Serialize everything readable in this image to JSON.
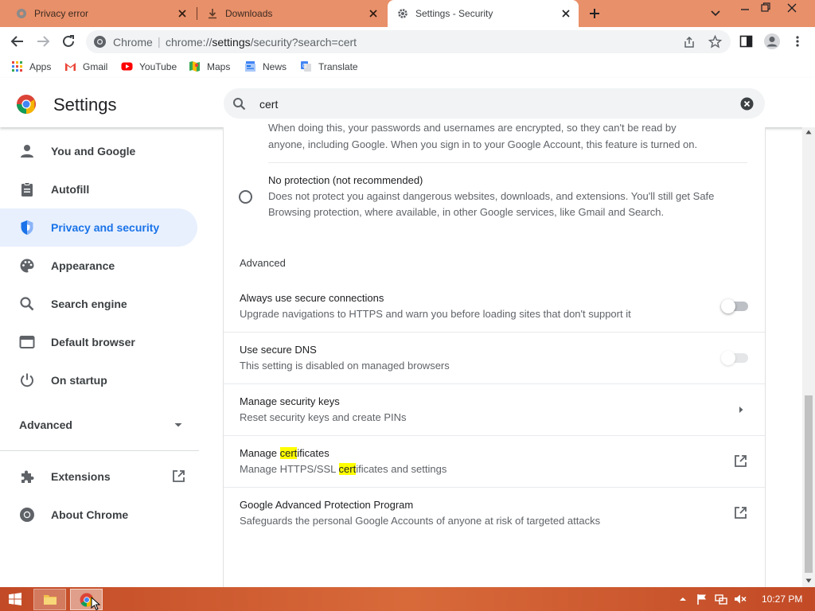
{
  "tabs": [
    {
      "label": "Privacy error",
      "icon": "globe-icon"
    },
    {
      "label": "Downloads",
      "icon": "download-icon"
    },
    {
      "label": "Settings - Security",
      "icon": "gear-icon"
    }
  ],
  "toolbar": {
    "site_label": "Chrome",
    "url_prefix": "chrome://",
    "url_host": "settings",
    "url_path": "/security?search=cert"
  },
  "bookmarks": [
    {
      "label": "Apps",
      "icon": "apps-grid-icon"
    },
    {
      "label": "Gmail",
      "icon": "gmail-icon"
    },
    {
      "label": "YouTube",
      "icon": "youtube-icon"
    },
    {
      "label": "Maps",
      "icon": "maps-icon"
    },
    {
      "label": "News",
      "icon": "news-icon"
    },
    {
      "label": "Translate",
      "icon": "translate-icon"
    }
  ],
  "header": {
    "title": "Settings",
    "search_value": "cert"
  },
  "sidebar": {
    "items": [
      {
        "label": "You and Google",
        "icon": "person-icon"
      },
      {
        "label": "Autofill",
        "icon": "clipboard-icon"
      },
      {
        "label": "Privacy and security",
        "icon": "shield-icon"
      },
      {
        "label": "Appearance",
        "icon": "palette-icon"
      },
      {
        "label": "Search engine",
        "icon": "search-icon"
      },
      {
        "label": "Default browser",
        "icon": "browser-window-icon"
      },
      {
        "label": "On startup",
        "icon": "power-icon"
      }
    ],
    "advanced_label": "Advanced",
    "extensions_label": "Extensions",
    "about_label": "About Chrome"
  },
  "content": {
    "top_text_line1": "When doing this, your passwords and usernames are encrypted, so they can't be read by",
    "top_text_line2": "anyone, including Google. When you sign in to your Google Account, this feature is turned on.",
    "no_protection_title": "No protection (not recommended)",
    "no_protection_line1": "Does not protect you against dangerous websites, downloads, and extensions. You'll still get Safe",
    "no_protection_line2": "Browsing protection, where available, in other Google services, like Gmail and Search.",
    "advanced_heading": "Advanced",
    "always_secure_title": "Always use secure connections",
    "always_secure_desc": "Upgrade navigations to HTTPS and warn you before loading sites that don't support it",
    "always_secure_on": false,
    "secure_dns_title": "Use secure DNS",
    "secure_dns_desc": "This setting is disabled on managed browsers",
    "secure_dns_on": false,
    "security_keys_title": "Manage security keys",
    "security_keys_desc": "Reset security keys and create PINs",
    "certs_title_pre": "Manage ",
    "certs_title_hl": "cert",
    "certs_title_post": "ificates",
    "certs_desc_pre": "Manage HTTPS/SSL ",
    "certs_desc_hl": "cert",
    "certs_desc_post": "ificates and settings",
    "gapp_title": "Google Advanced Protection Program",
    "gapp_desc": "Safeguards the personal Google Accounts of anyone at risk of targeted attacks"
  },
  "taskbar": {
    "clock": "10:27 PM"
  },
  "colors": {
    "tabstrip": "#e8906a",
    "accent": "#1a73e8",
    "highlight": "#ffff00",
    "taskbar": "#c8502a"
  }
}
